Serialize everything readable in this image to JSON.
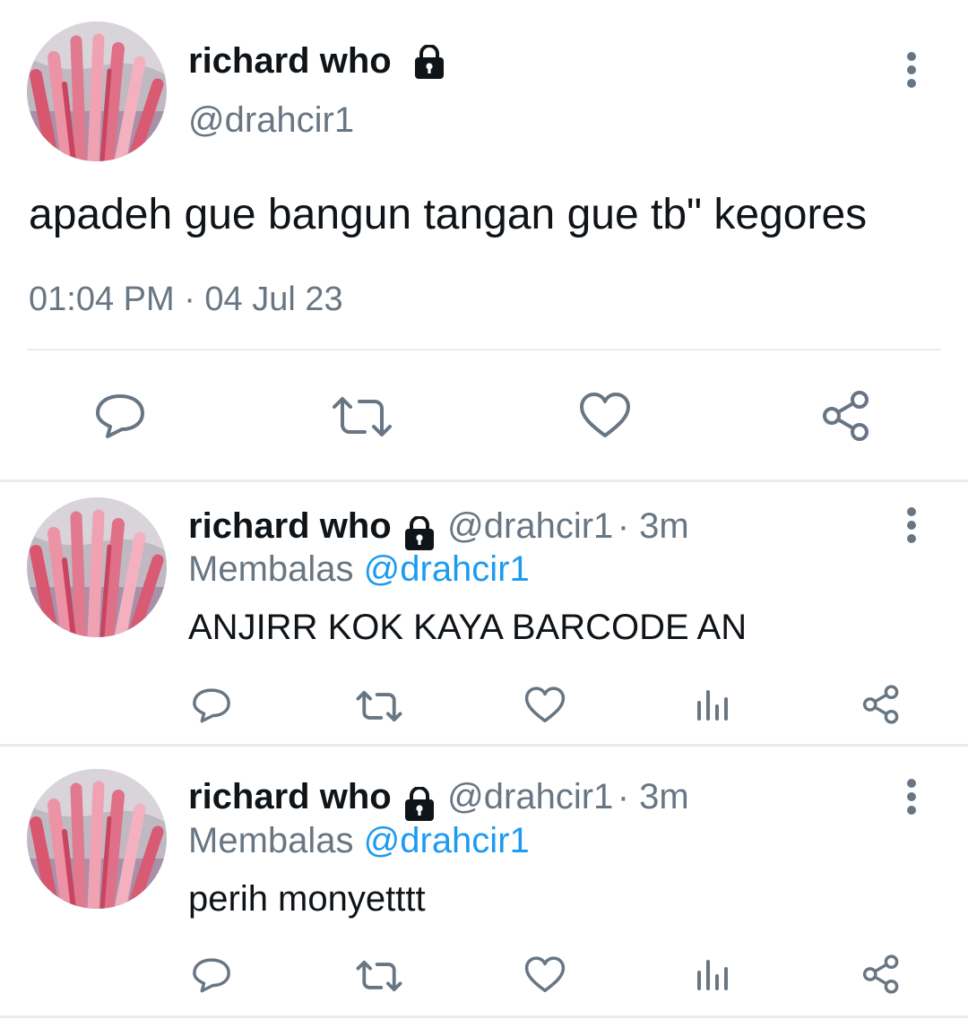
{
  "main_tweet": {
    "display_name": "richard who",
    "handle": "@drahcir1",
    "text": "apadeh gue bangun tangan gue tb\" kegores",
    "timestamp": "01:04 PM · 04 Jul 23",
    "icons": [
      "more-vertical-icon",
      "lock-icon",
      "reply-icon",
      "retweet-icon",
      "like-icon",
      "share-icon"
    ]
  },
  "replies": [
    {
      "display_name": "richard who",
      "handle": "@drahcir1",
      "age": "· 3m",
      "replying_prefix": "Membalas",
      "replying_to": "@drahcir1",
      "text": "ANJIRR KOK KAYA BARCODE AN"
    },
    {
      "display_name": "richard who",
      "handle": "@drahcir1",
      "age": "· 3m",
      "replying_prefix": "Membalas",
      "replying_to": "@drahcir1",
      "text": "perih monyetttt"
    }
  ],
  "colors": {
    "text": "#0f1419",
    "muted": "#687684",
    "link": "#1d9bf0",
    "divider": "#e6ecf0",
    "avatar_pink": "#e8879c"
  }
}
